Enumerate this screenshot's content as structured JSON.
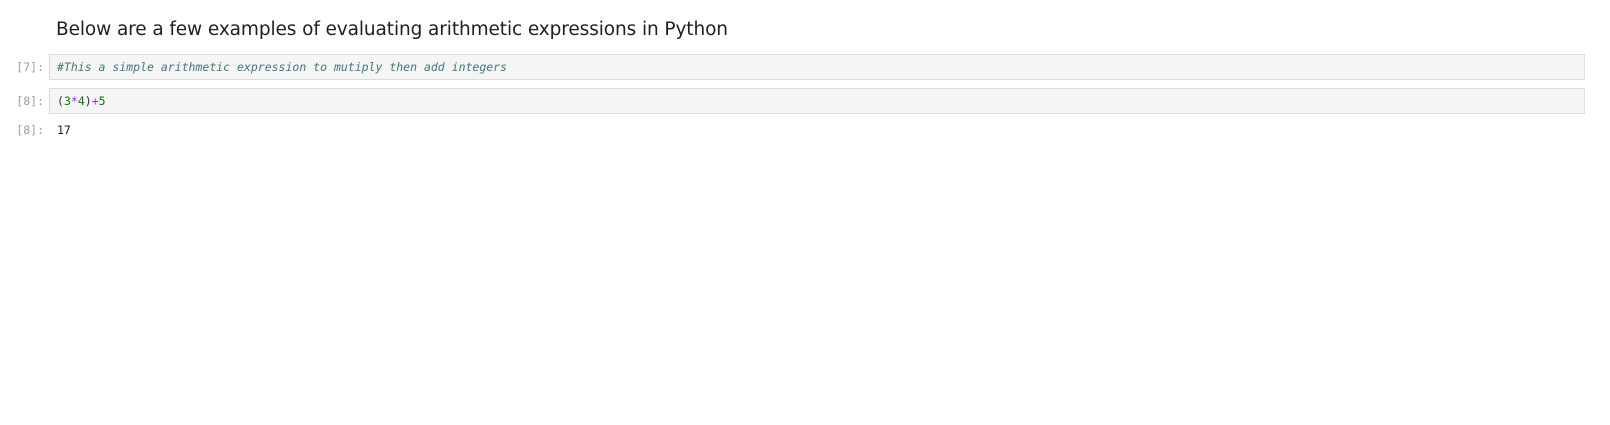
{
  "markdown": {
    "heading": "Below are a few examples of evaluating arithmetic expressions in Python"
  },
  "cells": [
    {
      "prompt": "[7]:",
      "code": "#This a simple arithmetic expression to mutiply then add integers"
    },
    {
      "prompt": "[8]:",
      "code_tokens": {
        "open_paren": "(",
        "num1": "3",
        "op1": "*",
        "num2": "4",
        "close_paren": ")",
        "op2": "+",
        "num3": "5"
      },
      "output_prompt": "[8]:",
      "output": "17"
    }
  ],
  "colors": {
    "comment": "#3d7a7a",
    "number": "#0a7a0a",
    "operator": "#aa22ff",
    "cell_background": "#f5f5f5",
    "cell_border": "#dcdcdc",
    "prompt": "#9e9e9e"
  }
}
